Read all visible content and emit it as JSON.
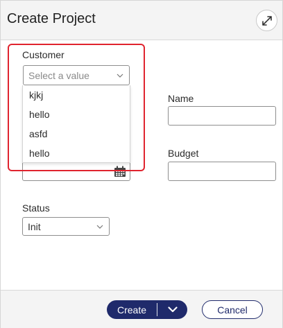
{
  "dialog": {
    "title": "Create Project",
    "expand_icon": "expand-arrows-icon"
  },
  "form": {
    "customer": {
      "label": "Customer",
      "placeholder": "Select a value",
      "options": [
        "kjkj",
        "hello",
        "asfd",
        "hello"
      ]
    },
    "name": {
      "label": "Name",
      "value": ""
    },
    "budget": {
      "label": "Budget",
      "value": ""
    },
    "date": {
      "value": "",
      "icon": "calendar-icon"
    },
    "status": {
      "label": "Status",
      "value": "Init"
    }
  },
  "footer": {
    "create_label": "Create",
    "cancel_label": "Cancel"
  },
  "colors": {
    "primary": "#1f2a6b",
    "highlight": "#e0232e",
    "panel_bg": "#f4f4f4",
    "field_border": "#8e8e8e"
  }
}
